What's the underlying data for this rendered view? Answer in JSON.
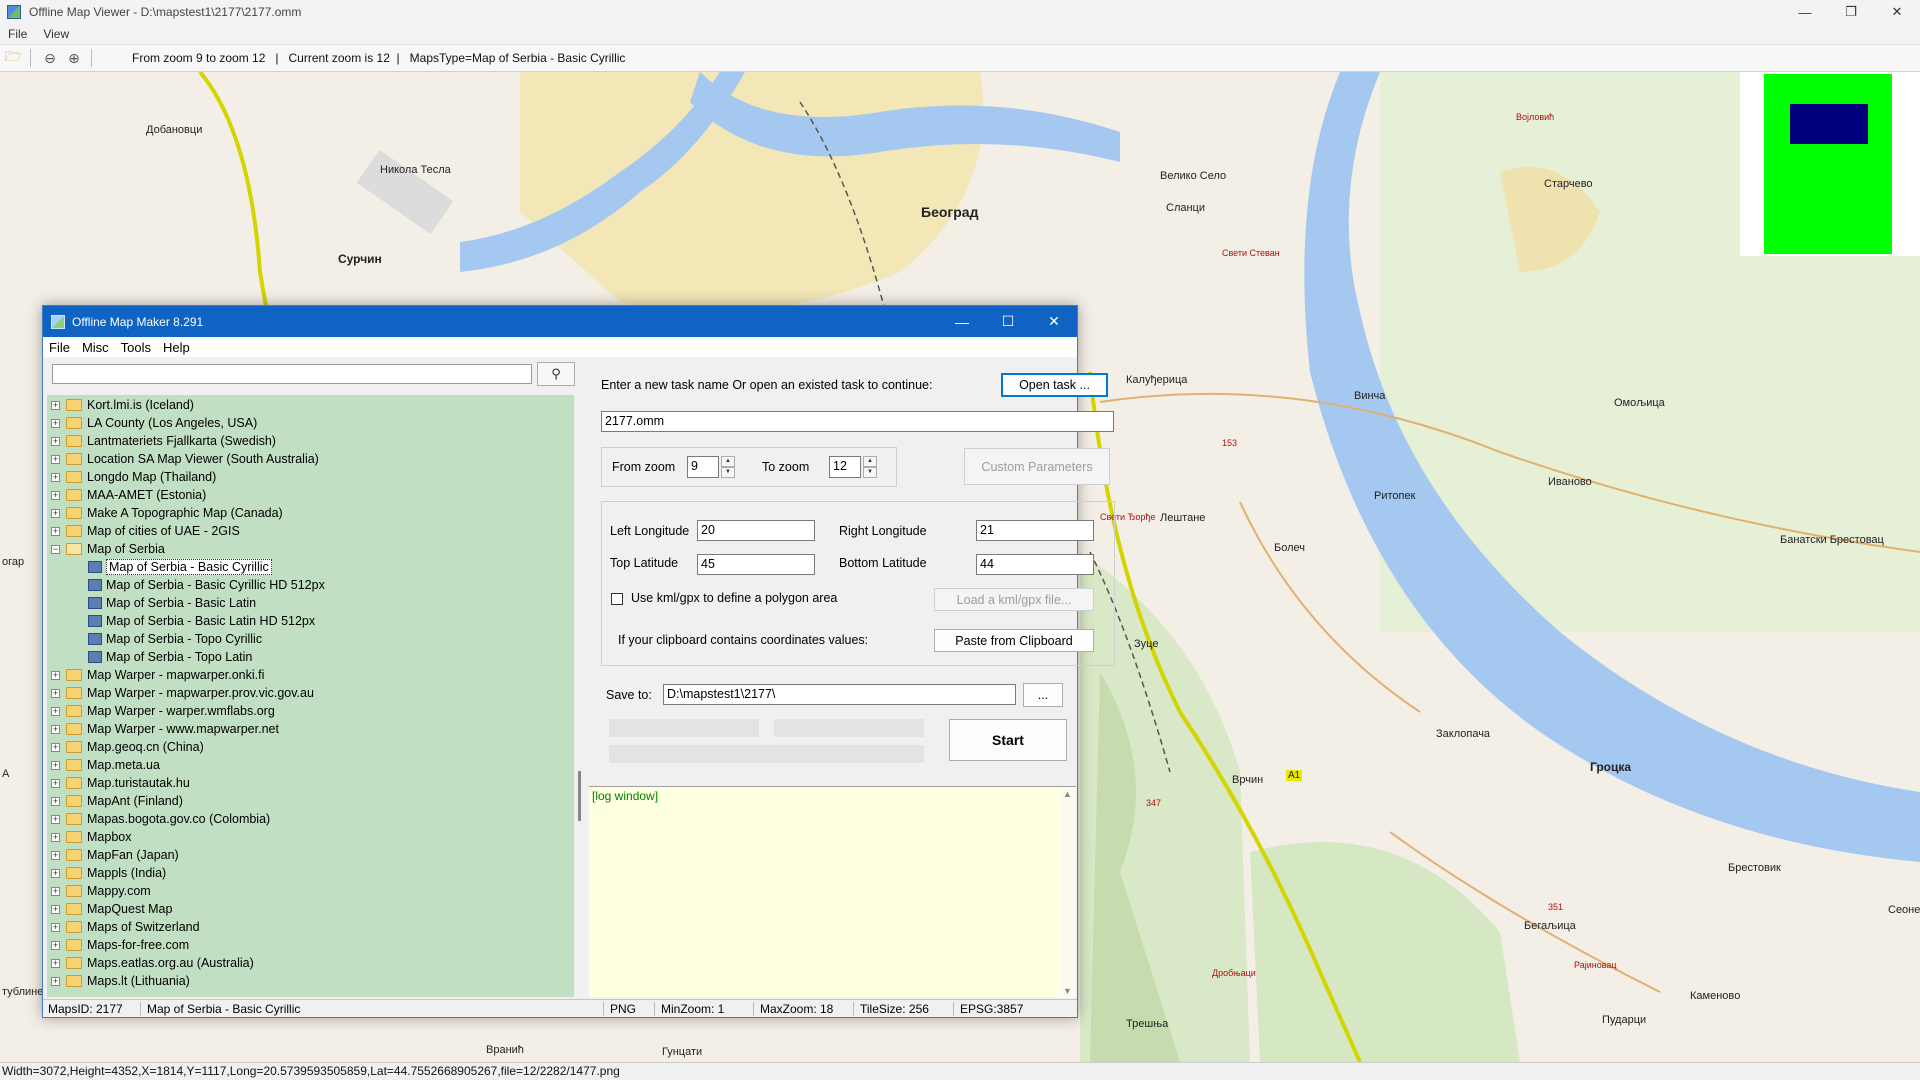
{
  "window": {
    "title": "Offline Map Viewer - D:\\mapstest1\\2177\\2177.omm",
    "controls": [
      "—",
      "❐",
      "✕"
    ]
  },
  "menu": [
    "File",
    "View"
  ],
  "toolbar": {
    "info": "From zoom 9 to zoom 12   |   Current zoom is 12  |   MapsType=Map of Serbia - Basic Cyrillic"
  },
  "map": {
    "labels": [
      {
        "text": "Добановци",
        "style": ""
      },
      {
        "text": "Никола Тесла",
        "style": ""
      },
      {
        "text": "Сурчин",
        "style": "bold"
      },
      {
        "text": "Београд",
        "style": "big"
      },
      {
        "text": "Велико Село",
        "style": ""
      },
      {
        "text": "Сланци",
        "style": ""
      },
      {
        "text": "Свети Стеван",
        "style": "red"
      },
      {
        "text": "Војловић",
        "style": "red"
      },
      {
        "text": "Старчево",
        "style": ""
      },
      {
        "text": "Калуђерица",
        "style": ""
      },
      {
        "text": "Винча",
        "style": ""
      },
      {
        "text": "Омољица",
        "style": ""
      },
      {
        "text": "Свети Ђорђе",
        "style": "red"
      },
      {
        "text": "Лештане",
        "style": ""
      },
      {
        "text": "Ритопек",
        "style": ""
      },
      {
        "text": "Иваново",
        "style": ""
      },
      {
        "text": "Болеч",
        "style": ""
      },
      {
        "text": "Банатски Брестовац",
        "style": ""
      },
      {
        "text": "Зуце",
        "style": ""
      },
      {
        "text": "Заклопача",
        "style": ""
      },
      {
        "text": "Врчин",
        "style": ""
      },
      {
        "text": "Гроцка",
        "style": "bold"
      },
      {
        "text": "Брестовик",
        "style": ""
      },
      {
        "text": "Бегаљица",
        "style": ""
      },
      {
        "text": "Сеоне",
        "style": ""
      },
      {
        "text": "Рајиновац",
        "style": "red"
      },
      {
        "text": "Дробњаци",
        "style": "red"
      },
      {
        "text": "Каменовo",
        "style": ""
      },
      {
        "text": "Пударци",
        "style": ""
      },
      {
        "text": "Трешња",
        "style": ""
      },
      {
        "text": "Вранић",
        "style": ""
      },
      {
        "text": "Гунцати",
        "style": ""
      },
      {
        "text": "огар",
        "style": ""
      },
      {
        "text": "тублине",
        "style": ""
      },
      {
        "text": "А",
        "style": ""
      },
      {
        "text": "153",
        "style": "red"
      },
      {
        "text": "347",
        "style": "red"
      },
      {
        "text": "351",
        "style": "red"
      },
      {
        "text": "А1",
        "style": ""
      }
    ]
  },
  "status": {
    "text": "Width=3072,Height=4352,X=1814,Y=1117,Long=20.5739593505859,Lat=44.7552668905267,file=12/2282/1477.png"
  },
  "dialog": {
    "title": "Offline Map Maker 8.291",
    "controls": [
      "—",
      "☐",
      "✕"
    ],
    "menu": [
      "File",
      "Misc",
      "Tools",
      "Help"
    ],
    "search": {
      "value": "",
      "icon": "search-icon"
    },
    "tree": [
      {
        "label": "Kort.lmi.is (Iceland)",
        "type": "folder"
      },
      {
        "label": "LA County (Los Angeles, USA)",
        "type": "folder"
      },
      {
        "label": "Lantmateriets Fjallkarta (Swedish)",
        "type": "folder"
      },
      {
        "label": "Location SA Map Viewer (South Australia)",
        "type": "folder"
      },
      {
        "label": "Longdo Map (Thailand)",
        "type": "folder"
      },
      {
        "label": "MAA-AMET (Estonia)",
        "type": "folder"
      },
      {
        "label": "Make A Topographic Map (Canada)",
        "type": "folder"
      },
      {
        "label": "Map of cities of UAE - 2GIS",
        "type": "folder"
      },
      {
        "label": "Map of Serbia",
        "type": "open"
      },
      {
        "label": "Map of Serbia - Basic Cyrillic",
        "type": "child",
        "selected": true
      },
      {
        "label": "Map of Serbia - Basic Cyrillic HD 512px",
        "type": "child"
      },
      {
        "label": "Map of Serbia - Basic Latin",
        "type": "child"
      },
      {
        "label": "Map of Serbia - Basic Latin HD 512px",
        "type": "child"
      },
      {
        "label": "Map of Serbia - Topo Cyrillic",
        "type": "child"
      },
      {
        "label": "Map of Serbia - Topo Latin",
        "type": "child"
      },
      {
        "label": "Map Warper - mapwarper.onki.fi",
        "type": "folder"
      },
      {
        "label": "Map Warper - mapwarper.prov.vic.gov.au",
        "type": "folder"
      },
      {
        "label": "Map Warper - warper.wmflabs.org",
        "type": "folder"
      },
      {
        "label": "Map Warper - www.mapwarper.net",
        "type": "folder"
      },
      {
        "label": "Map.geoq.cn (China)",
        "type": "folder"
      },
      {
        "label": "Map.meta.ua",
        "type": "folder"
      },
      {
        "label": "Map.turistautak.hu",
        "type": "folder"
      },
      {
        "label": "MapAnt (Finland)",
        "type": "folder"
      },
      {
        "label": "Mapas.bogota.gov.co (Colombia)",
        "type": "folder"
      },
      {
        "label": "Mapbox",
        "type": "folder"
      },
      {
        "label": "MapFan (Japan)",
        "type": "folder"
      },
      {
        "label": "Mappls (India)",
        "type": "folder"
      },
      {
        "label": "Mappy.com",
        "type": "folder"
      },
      {
        "label": "MapQuest Map",
        "type": "folder"
      },
      {
        "label": "Maps of Switzerland",
        "type": "folder"
      },
      {
        "label": "Maps-for-free.com",
        "type": "folder"
      },
      {
        "label": "Maps.eatlas.org.au (Australia)",
        "type": "folder"
      },
      {
        "label": "Maps.lt (Lithuania)",
        "type": "folder"
      }
    ],
    "task_prompt": "Enter a new task name Or open an existed task to continue:",
    "open_task": "Open task ...",
    "task_name": "2177.omm",
    "from_zoom_label": "From zoom",
    "from_zoom": "9",
    "to_zoom_label": "To zoom",
    "to_zoom": "12",
    "custom_params": "Custom Parameters",
    "left_lon_label": "Left Longitude",
    "left_lon": "20",
    "right_lon_label": "Right Longitude",
    "right_lon": "21",
    "top_lat_label": "Top Latitude",
    "top_lat": "45",
    "bottom_lat_label": "Bottom Latitude",
    "bottom_lat": "44",
    "kml_label": "Use kml/gpx to define a polygon area",
    "kml_button": "Load a kml/gpx file...",
    "clipboard_label": "If your clipboard contains coordinates values:",
    "clipboard_button": "Paste from Clipboard",
    "save_label": "Save to:",
    "save_path": "D:\\mapstest1\\2177\\",
    "browse": "...",
    "start": "Start",
    "log": "[log window]",
    "status": {
      "maps_id": "MapsID: 2177",
      "map_name": "Map of Serbia - Basic Cyrillic",
      "format": "PNG",
      "min_zoom": "MinZoom: 1",
      "max_zoom": "MaxZoom: 18",
      "tile_size": "TileSize: 256",
      "epsg": "EPSG:3857"
    }
  }
}
